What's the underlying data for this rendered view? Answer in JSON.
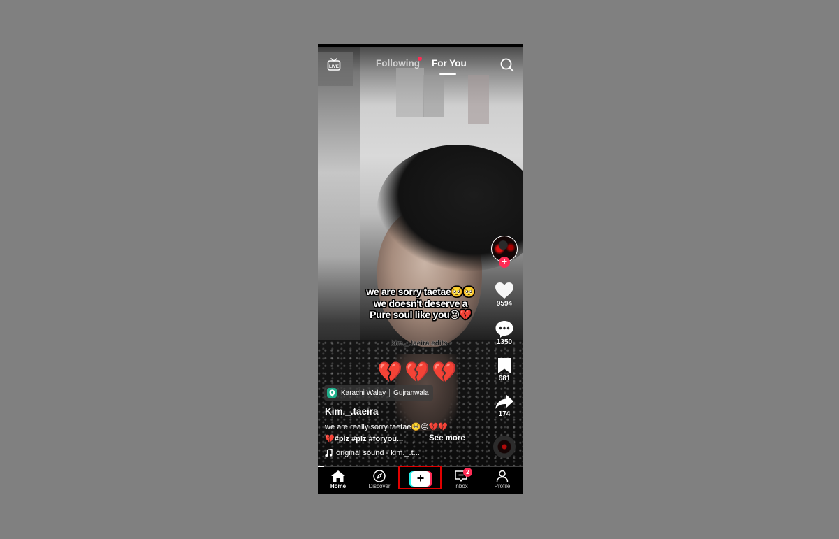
{
  "top_bar": {
    "live_icon": "live-tv-icon",
    "live_label": "LIVE",
    "tabs": [
      {
        "label": "Following",
        "active": false,
        "has_notification_dot": true
      },
      {
        "label": "For You",
        "active": true
      }
    ],
    "search_icon": "search-icon"
  },
  "video": {
    "caption_lines": [
      "we are sorry taetae🥺🥺",
      "we doesn't deserve a",
      "Pure soul like you😔💔"
    ],
    "watermark": "kim._.taeira edits",
    "sticker_hearts": "💔💔💔"
  },
  "right_rail": {
    "creator_avatar": "creator-avatar",
    "follow_symbol": "+",
    "likes": "9594",
    "comments": "1350",
    "saves": "681",
    "shares": "174"
  },
  "post_info": {
    "location_name": "Karachi Walay",
    "location_city": "Gujranwala",
    "username": "Kim._.taeira",
    "description_line1": "we are really sorry taetae🥺😔💔💔",
    "description_line2": "💔#plz #plz #foryou...",
    "see_more": "See more",
    "sound": "original sound - kim._.t..."
  },
  "playback": {
    "progress_fraction": 0.03
  },
  "bottom_nav": {
    "items": [
      {
        "label": "Home",
        "icon": "home-icon",
        "active": true
      },
      {
        "label": "Discover",
        "icon": "compass-icon",
        "active": false
      },
      {
        "label": "",
        "icon": "create-plus-icon",
        "active": false
      },
      {
        "label": "Inbox",
        "icon": "inbox-icon",
        "active": false,
        "badge": "2"
      },
      {
        "label": "Profile",
        "icon": "profile-icon",
        "active": false
      }
    ],
    "create_symbol": "+"
  },
  "colors": {
    "accent_red": "#fe2c55",
    "accent_cyan": "#25f4ee",
    "location_green": "#20b08c",
    "highlight_box": "#e00000"
  }
}
